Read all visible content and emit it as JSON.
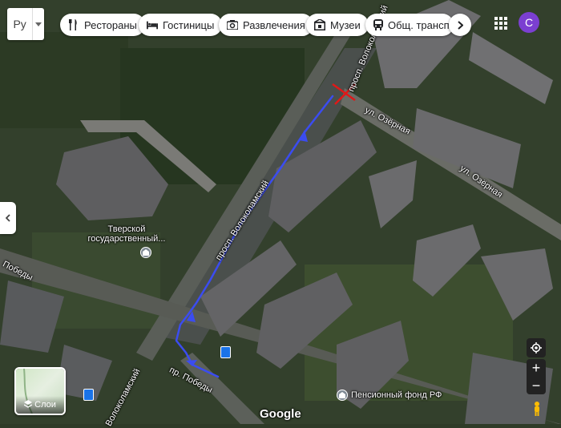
{
  "language": {
    "code": "Ру"
  },
  "categories": [
    {
      "label": "Рестораны",
      "icon": "fork-knife-icon"
    },
    {
      "label": "Гостиницы",
      "icon": "bed-icon"
    },
    {
      "label": "Развлечения",
      "icon": "camera-icon"
    },
    {
      "label": "Музеи",
      "icon": "museum-icon"
    },
    {
      "label": "Общ. транспо",
      "icon": "transit-icon"
    }
  ],
  "account": {
    "initial": "C",
    "color": "#7b3fd1"
  },
  "map": {
    "streets": {
      "volokolamsky_top": "просп. Волоколамский",
      "volokolamsky_mid": "просп. Волоколамский",
      "volokolamsky_bottom": "Волоколамский",
      "ozernaya_1": "ул. Озёрная",
      "ozernaya_2": "ул. Озёрная",
      "pobedy_left": "Победы",
      "pobedy_bottom": "пр. Победы"
    },
    "places": {
      "university": "Тверской государственный...",
      "pension_fund": "Пенсионный фонд РФ"
    },
    "route_color": "#3b4cf0",
    "closure_color": "#e01818"
  },
  "controls": {
    "layers_label": "Слои",
    "zoom_in": "+",
    "zoom_out": "−"
  },
  "logo": "Google"
}
